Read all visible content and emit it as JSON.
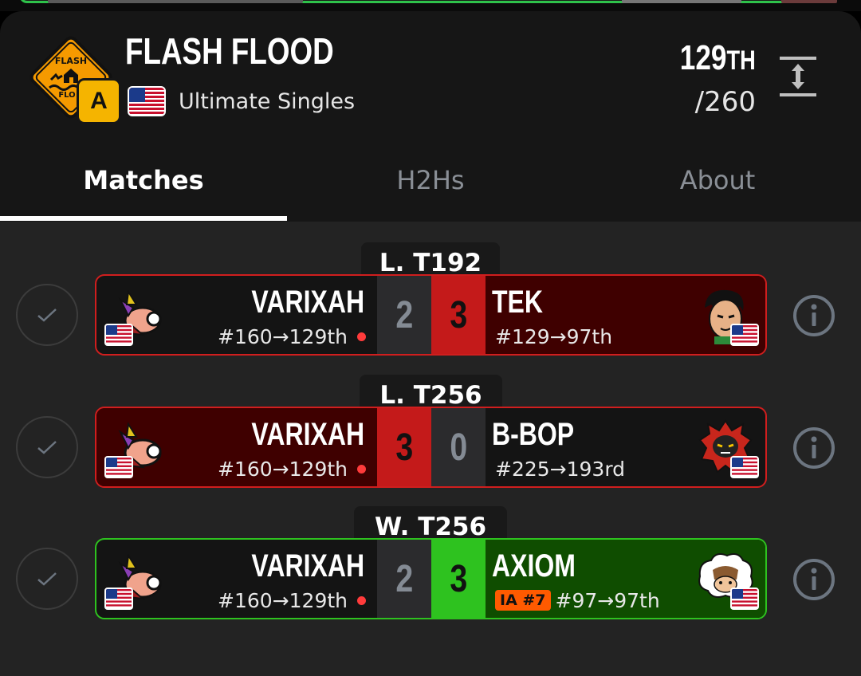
{
  "event": {
    "title": "FLASH FLOOD",
    "tier": "A",
    "game": "Ultimate Singles",
    "country_flag": "us-flag",
    "placement_number": "129",
    "placement_suffix": "TH",
    "total_entrants": "/260",
    "logo_icon": "flash-flood-warning-sign-logo"
  },
  "tabs": [
    {
      "label": "Matches",
      "active": true
    },
    {
      "label": "H2Hs",
      "active": false
    },
    {
      "label": "About",
      "active": false
    }
  ],
  "matches": [
    {
      "round": "L. T192",
      "result": "loss",
      "left": {
        "name": "VARIXAH",
        "seed": "#160→129th",
        "score": "2",
        "avatar": "character-icon-ridley"
      },
      "right": {
        "name": "TEK",
        "seed": "#129→97th",
        "score": "3",
        "avatar": "character-icon-little-mac"
      }
    },
    {
      "round": "L. T256",
      "result": "win",
      "left": {
        "name": "VARIXAH",
        "seed": "#160→129th",
        "score": "3",
        "avatar": "character-icon-ridley"
      },
      "right": {
        "name": "B-BOP",
        "seed": "#225→193rd",
        "score": "0",
        "avatar": "character-icon-incineroar"
      }
    },
    {
      "round": "W. T256",
      "result": "loss",
      "left": {
        "name": "VARIXAH",
        "seed": "#160→129th",
        "score": "2",
        "avatar": "character-icon-ridley"
      },
      "right": {
        "name": "AXIOM",
        "seed": "#97→97th",
        "score": "3",
        "badge": "IA #7",
        "avatar": "character-icon-villager"
      }
    }
  ],
  "colors": {
    "loss_red": "#c41a1a",
    "win_green": "#2ec21f",
    "tier_gold": "#f5b400",
    "badge_orange": "#ff5a00"
  }
}
